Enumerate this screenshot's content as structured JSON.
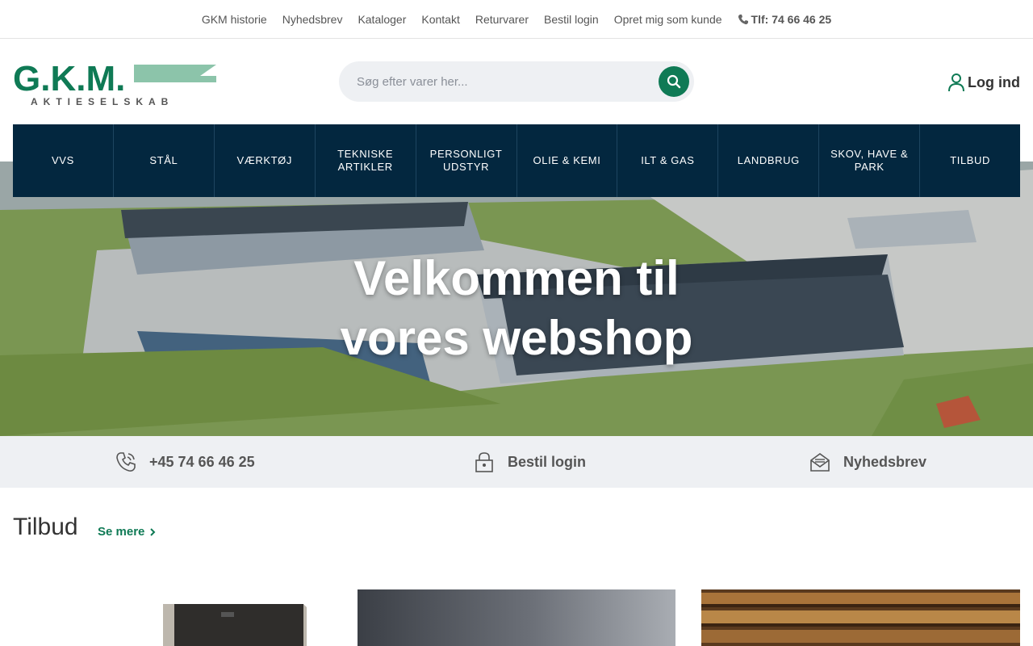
{
  "topbar": {
    "links": [
      "GKM historie",
      "Nyhedsbrev",
      "Kataloger",
      "Kontakt",
      "Returvarer",
      "Bestil login",
      "Opret mig som kunde"
    ],
    "phone": "Tlf: 74 66 46 25"
  },
  "logo": {
    "letters": "G.K.M.",
    "tagline": "AKTIESELSKAB"
  },
  "search": {
    "placeholder": "Søg efter varer her..."
  },
  "account": {
    "login_label": "Log ind"
  },
  "categories": [
    "VVS",
    "STÅL",
    "VÆRKTØJ",
    "TEKNISKE ARTIKLER",
    "PERSONLIGT UDSTYR",
    "OLIE & KEMI",
    "ILT & GAS",
    "LANDBRUG",
    "SKOV, HAVE & PARK",
    "TILBUD"
  ],
  "hero": {
    "line1": "Velkommen til",
    "line2": "vores webshop"
  },
  "info": {
    "phone": "+45 74 66 46 25",
    "login": "Bestil login",
    "newsletter": "Nyhedsbrev"
  },
  "offers": {
    "title": "Tilbud",
    "see_more": "Se mere"
  },
  "colors": {
    "brand_green": "#0f7a55",
    "nav_navy": "#03273f",
    "logo_light_green": "#8cc4aa"
  }
}
